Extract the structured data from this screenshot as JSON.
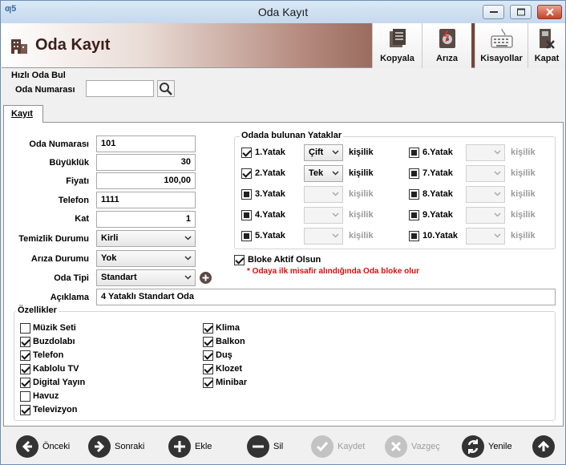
{
  "window": {
    "title": "Oda Kayıt",
    "app_logo": "ƣ5"
  },
  "header": {
    "title": "Oda Kayıt",
    "icon": "building-icon",
    "toolbar": [
      {
        "label": "Kopyala",
        "icon": "copy-icon"
      },
      {
        "label": "Arıza",
        "icon": "fault-icon"
      },
      {
        "label": "Kisayollar",
        "icon": "keyboard-icon"
      },
      {
        "label": "Kapat",
        "icon": "close-door-icon"
      }
    ]
  },
  "quick_find": {
    "title": "Hızlı Oda Bul",
    "room_label": "Oda Numarası",
    "room_value": "",
    "search_icon": "search-icon"
  },
  "tab": {
    "label": "Kayıt"
  },
  "form": {
    "room_no": {
      "label": "Oda Numarası",
      "value": "101"
    },
    "size": {
      "label": "Büyüklük",
      "value": "30"
    },
    "price": {
      "label": "Fiyatı",
      "value": "100,00"
    },
    "phone": {
      "label": "Telefon",
      "value": "1111"
    },
    "floor": {
      "label": "Kat",
      "value": "1"
    },
    "clean": {
      "label": "Temizlik Durumu",
      "value": "Kirli"
    },
    "fault": {
      "label": "Arıza Durumu",
      "value": "Yok"
    },
    "type": {
      "label": "Oda Tipi",
      "value": "Standart"
    },
    "desc": {
      "label": "Açıklama",
      "value": "4 Yataklı Standart Oda"
    }
  },
  "beds": {
    "title": "Odada bulunan Yataklar",
    "unit": "kişilik",
    "items": [
      {
        "label": "1.Yatak",
        "checked": true,
        "value": "Çift"
      },
      {
        "label": "2.Yatak",
        "checked": true,
        "value": "Tek"
      },
      {
        "label": "3.Yatak",
        "checked": false,
        "value": ""
      },
      {
        "label": "4.Yatak",
        "checked": false,
        "value": ""
      },
      {
        "label": "5.Yatak",
        "checked": false,
        "value": ""
      },
      {
        "label": "6.Yatak",
        "checked": false,
        "value": ""
      },
      {
        "label": "7.Yatak",
        "checked": false,
        "value": ""
      },
      {
        "label": "8.Yatak",
        "checked": false,
        "value": ""
      },
      {
        "label": "9.Yatak",
        "checked": false,
        "value": ""
      },
      {
        "label": "10.Yatak",
        "checked": false,
        "value": ""
      }
    ]
  },
  "block": {
    "label": "Bloke Aktif Olsun",
    "checked": true,
    "note": "* Odaya ilk misafir alındığında Oda bloke olur"
  },
  "features": {
    "title": "Özellikler",
    "left": [
      {
        "label": "Müzik Seti",
        "checked": false
      },
      {
        "label": "Buzdolabı",
        "checked": true
      },
      {
        "label": "Telefon",
        "checked": true
      },
      {
        "label": "Kablolu TV",
        "checked": true
      },
      {
        "label": "Digital Yayın",
        "checked": true
      },
      {
        "label": "Havuz",
        "checked": false
      },
      {
        "label": "Televizyon",
        "checked": true
      }
    ],
    "right": [
      {
        "label": "Klima",
        "checked": true
      },
      {
        "label": "Balkon",
        "checked": true
      },
      {
        "label": "Duş",
        "checked": true
      },
      {
        "label": "Klozet",
        "checked": true
      },
      {
        "label": "Minibar",
        "checked": true
      }
    ]
  },
  "nav": {
    "prev": "Önceki",
    "next": "Sonraki",
    "add": "Ekle",
    "del": "Sil",
    "save": "Kaydet",
    "cancel": "Vazgeç",
    "refresh": "Yenile"
  }
}
